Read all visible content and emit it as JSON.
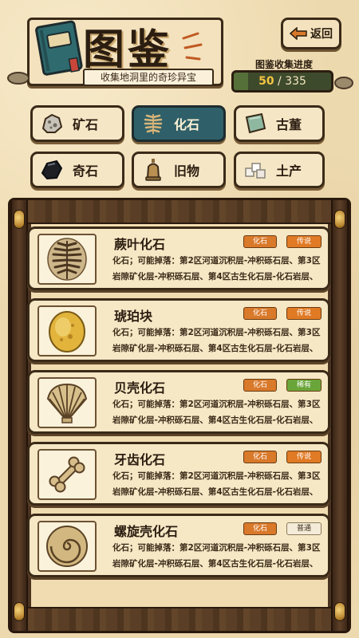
{
  "header": {
    "title": "图鉴",
    "subtitle": "收集地洞里的奇珍异宝",
    "back_label": "返回",
    "progress_label": "图鉴收集进度",
    "progress_current": "50",
    "progress_sep": " / ",
    "progress_total": "335",
    "progress_fraction": 0.149
  },
  "tabs": [
    {
      "label": "矿石",
      "icon": "ore-icon",
      "active": false
    },
    {
      "label": "化石",
      "icon": "fern-fossil-icon",
      "active": true
    },
    {
      "label": "古董",
      "icon": "jade-icon",
      "active": false
    },
    {
      "label": "奇石",
      "icon": "black-stone-icon",
      "active": false
    },
    {
      "label": "旧物",
      "icon": "bell-icon",
      "active": false
    },
    {
      "label": "土产",
      "icon": "salt-crystal-icon",
      "active": false
    }
  ],
  "items": [
    {
      "name": "蕨叶化石",
      "type": "化石",
      "rarity": "传说",
      "rarity_color": "#e07a24",
      "desc": "化石；可能掉落：第2区河道沉积层-冲积砾石层、第3区岩隙矿化层-冲积砾石层、第4区古生化石层-化石岩层、第4",
      "icon": "fern-fossil-icon"
    },
    {
      "name": "琥珀块",
      "type": "化石",
      "rarity": "传说",
      "rarity_color": "#e07a24",
      "desc": "化石；可能掉落：第2区河道沉积层-冲积砾石层、第3区岩隙矿化层-冲积砾石层、第4区古生化石层-化石岩层、第4",
      "icon": "amber-icon"
    },
    {
      "name": "贝壳化石",
      "type": "化石",
      "rarity": "稀有",
      "rarity_color": "#6aa53a",
      "desc": "化石；可能掉落：第2区河道沉积层-冲积砾石层、第3区岩隙矿化层-冲积砾石层、第4区古生化石层-化石岩层、第4",
      "icon": "shell-fossil-icon"
    },
    {
      "name": "牙齿化石",
      "type": "化石",
      "rarity": "传说",
      "rarity_color": "#e07a24",
      "desc": "化石；可能掉落：第2区河道沉积层-冲积砾石层、第3区岩隙矿化层-冲积砾石层、第4区古生化石层-化石岩层、第4",
      "icon": "bone-fossil-icon"
    },
    {
      "name": "螺旋壳化石",
      "type": "化石",
      "rarity": "普通",
      "rarity_color": "#f4ecd8",
      "desc": "化石；可能掉落：第2区河道沉积层-冲积砾石层、第3区岩隙矿化层-冲积砾石层、第4区古生化石层-化石岩层、第4",
      "icon": "ammonite-icon"
    }
  ]
}
